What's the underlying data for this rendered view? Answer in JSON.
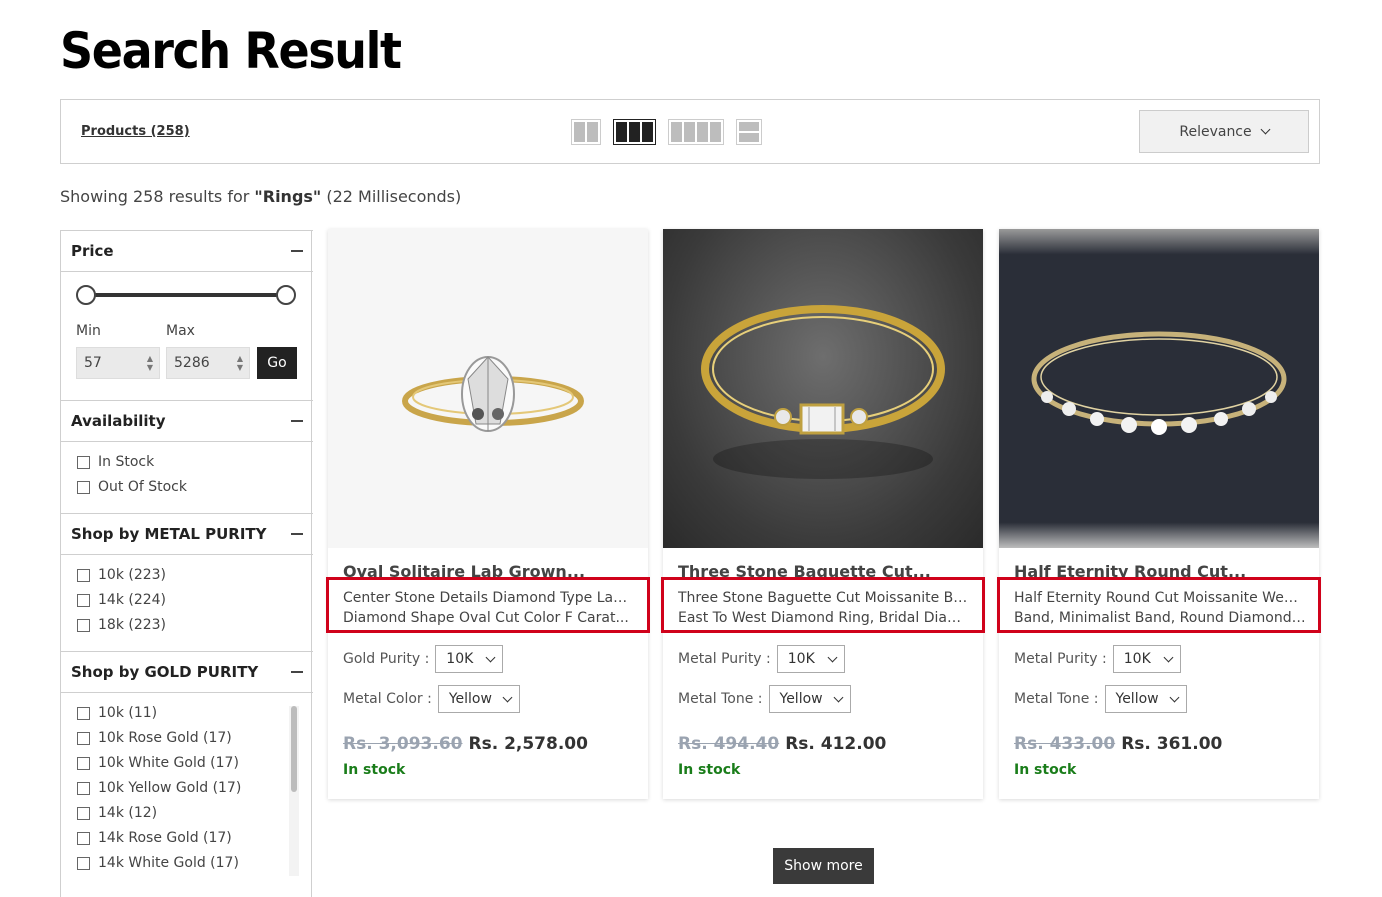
{
  "page": {
    "title": "Search Result"
  },
  "toolbar": {
    "products_label": "Products (258)",
    "sort_label": "Relevance",
    "view_icons": [
      "grid-2-icon",
      "grid-3-icon",
      "grid-4-icon",
      "list-view-icon"
    ]
  },
  "results": {
    "prefix": "Showing 258 results for ",
    "query": "\"Rings\"",
    "suffix": " (22 Milliseconds)"
  },
  "filters": {
    "price": {
      "title": "Price",
      "min_label": "Min",
      "max_label": "Max",
      "min_value": "57",
      "max_value": "5286",
      "go_label": "Go"
    },
    "availability": {
      "title": "Availability",
      "options": [
        "In Stock",
        "Out Of Stock"
      ]
    },
    "metal_purity": {
      "title": "Shop by METAL PURITY",
      "options": [
        "10k (223)",
        "14k (224)",
        "18k (223)"
      ]
    },
    "gold_purity": {
      "title": "Shop by GOLD PURITY",
      "options": [
        "10k (11)",
        "10k Rose Gold (17)",
        "10k White Gold (17)",
        "10k Yellow Gold (17)",
        "14k (12)",
        "14k Rose Gold (17)",
        "14k White Gold (17)"
      ]
    }
  },
  "products": [
    {
      "title": "Oval Solitaire Lab Grown...",
      "desc_line1": "Center Stone Details Diamond Type Lab Grown",
      "desc_line2": "Diamond Shape Oval Cut Color F Carat...",
      "opt1_label": "Gold Purity :",
      "opt1_value": "10K",
      "opt2_label": "Metal Color :",
      "opt2_value": "Yellow",
      "old_price": "Rs. 3,093.60",
      "new_price": "Rs. 2,578.00",
      "stock": "In stock"
    },
    {
      "title": "Three Stone Baguette Cut...",
      "desc_line1": "Three Stone Baguette Cut Moissanite Band,",
      "desc_line2": "East To West Diamond  Ring, Bridal Diamon...",
      "opt1_label": "Metal Purity :",
      "opt1_value": "10K",
      "opt2_label": "Metal Tone :",
      "opt2_value": "Yellow",
      "old_price": "Rs. 494.40",
      "new_price": "Rs. 412.00",
      "stock": "In stock"
    },
    {
      "title": "Half Eternity Round Cut...",
      "desc_line1": "Half Eternity Round Cut Moissanite Wedding",
      "desc_line2": "Band, Minimalist Band, Round Diamond Ring...",
      "opt1_label": "Metal Purity :",
      "opt1_value": "10K",
      "opt2_label": "Metal Tone :",
      "opt2_value": "Yellow",
      "old_price": "Rs. 433.00",
      "new_price": "Rs. 361.00",
      "stock": "In stock"
    }
  ],
  "show_more_label": "Show more",
  "colors": {
    "highlight_border": "#d0021b",
    "in_stock": "#1a7d1a",
    "old_price": "#9aa3b0"
  }
}
